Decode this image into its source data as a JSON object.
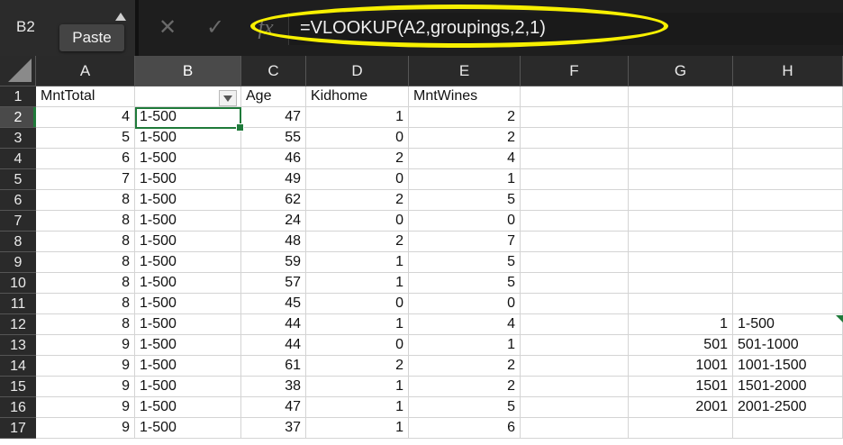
{
  "name_box": {
    "value": "B2"
  },
  "tooltip": {
    "label": "Paste"
  },
  "toolbar": {
    "cancel_icon": "close-icon",
    "enter_icon": "checkmark-icon",
    "function_icon": "fx"
  },
  "formula": {
    "text": "=VLOOKUP(A2,groupings,2,1)"
  },
  "colors": {
    "header_bg": "#2a2a2a",
    "selection": "#1f7a3a",
    "highlight": "#f7f000"
  },
  "sheet": {
    "columns": [
      "A",
      "B",
      "C",
      "D",
      "E",
      "F",
      "G",
      "H"
    ],
    "active_cell": "B2",
    "rows": [
      {
        "row": "1",
        "A": "MntTotal",
        "B": "",
        "C": "Age",
        "D": "Kidhome",
        "E": "MntWines",
        "F": "",
        "G": "",
        "H": ""
      },
      {
        "row": "2",
        "A": "4",
        "B": "1-500",
        "C": "47",
        "D": "1",
        "E": "2",
        "F": "",
        "G": "",
        "H": ""
      },
      {
        "row": "3",
        "A": "5",
        "B": "1-500",
        "C": "55",
        "D": "0",
        "E": "2",
        "F": "",
        "G": "",
        "H": ""
      },
      {
        "row": "4",
        "A": "6",
        "B": "1-500",
        "C": "46",
        "D": "2",
        "E": "4",
        "F": "",
        "G": "",
        "H": ""
      },
      {
        "row": "5",
        "A": "7",
        "B": "1-500",
        "C": "49",
        "D": "0",
        "E": "1",
        "F": "",
        "G": "",
        "H": ""
      },
      {
        "row": "6",
        "A": "8",
        "B": "1-500",
        "C": "62",
        "D": "2",
        "E": "5",
        "F": "",
        "G": "",
        "H": ""
      },
      {
        "row": "7",
        "A": "8",
        "B": "1-500",
        "C": "24",
        "D": "0",
        "E": "0",
        "F": "",
        "G": "",
        "H": ""
      },
      {
        "row": "8",
        "A": "8",
        "B": "1-500",
        "C": "48",
        "D": "2",
        "E": "7",
        "F": "",
        "G": "",
        "H": ""
      },
      {
        "row": "9",
        "A": "8",
        "B": "1-500",
        "C": "59",
        "D": "1",
        "E": "5",
        "F": "",
        "G": "",
        "H": ""
      },
      {
        "row": "10",
        "A": "8",
        "B": "1-500",
        "C": "57",
        "D": "1",
        "E": "5",
        "F": "",
        "G": "",
        "H": ""
      },
      {
        "row": "11",
        "A": "8",
        "B": "1-500",
        "C": "45",
        "D": "0",
        "E": "0",
        "F": "",
        "G": "",
        "H": ""
      },
      {
        "row": "12",
        "A": "8",
        "B": "1-500",
        "C": "44",
        "D": "1",
        "E": "4",
        "F": "",
        "G": "1",
        "H": "1-500"
      },
      {
        "row": "13",
        "A": "9",
        "B": "1-500",
        "C": "44",
        "D": "0",
        "E": "1",
        "F": "",
        "G": "501",
        "H": "501-1000"
      },
      {
        "row": "14",
        "A": "9",
        "B": "1-500",
        "C": "61",
        "D": "2",
        "E": "2",
        "F": "",
        "G": "1001",
        "H": "1001-1500"
      },
      {
        "row": "15",
        "A": "9",
        "B": "1-500",
        "C": "38",
        "D": "1",
        "E": "2",
        "F": "",
        "G": "1501",
        "H": "1501-2000"
      },
      {
        "row": "16",
        "A": "9",
        "B": "1-500",
        "C": "47",
        "D": "1",
        "E": "5",
        "F": "",
        "G": "2001",
        "H": "2001-2500"
      },
      {
        "row": "17",
        "A": "9",
        "B": "1-500",
        "C": "37",
        "D": "1",
        "E": "6",
        "F": "",
        "G": "",
        "H": ""
      }
    ]
  }
}
